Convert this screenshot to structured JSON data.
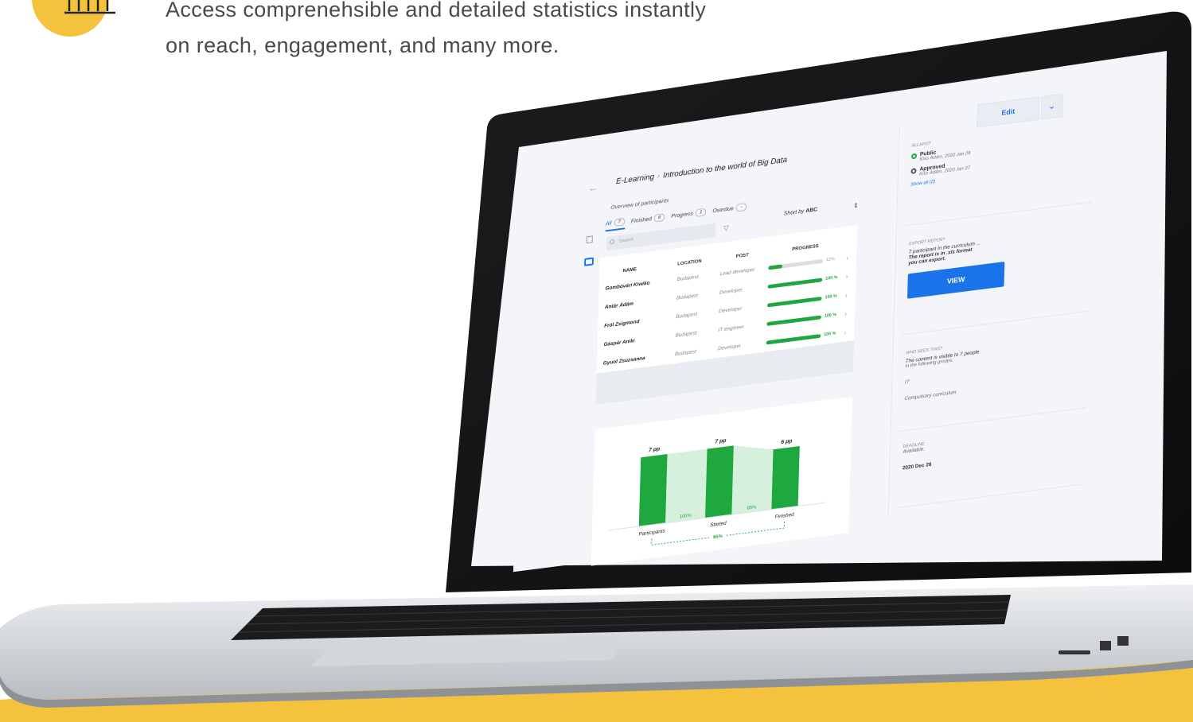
{
  "hero": {
    "line1": "Access comprenehsible and detailed  statistics instantly",
    "line2": "on reach, engagement, and many more."
  },
  "colors": {
    "accent_yellow": "#f5c23e",
    "primary_blue": "#1a73e8",
    "success_green": "#1fa840"
  },
  "icons": {
    "stats": "bar-chart-icon",
    "back": "back-arrow-icon",
    "search": "search-icon",
    "filter": "filter-icon",
    "sort": "sort-icon",
    "row_chevron": "chevron-right-icon",
    "dropdown": "chevron-down-icon"
  },
  "app": {
    "edit_label": "Edit",
    "dropdown_glyph": "⌄",
    "back_glyph": "←",
    "breadcrumb": {
      "root": "E-Learning",
      "sep": "›",
      "current": "Introduction to the world of Big Data"
    },
    "overview_label": "Overview of participants",
    "tabs": [
      {
        "label": "All",
        "count": "7"
      },
      {
        "label": "Finished",
        "count": "6"
      },
      {
        "label": "Progress",
        "count": "1"
      },
      {
        "label": "Overdue",
        "count": "-"
      }
    ],
    "search_placeholder": "Search",
    "sort_label": "Short by",
    "sort_value": "ABC",
    "columns": {
      "name": "NAME",
      "location": "LOCATION",
      "post": "POST",
      "progress": "PROGRESS"
    },
    "rows": [
      {
        "name": "Gombóvári Kiwiko",
        "location": "Budapest",
        "post": "Lead developer",
        "progress": 0.12,
        "pct": "12%"
      },
      {
        "name": "Antár Ádám",
        "location": "Budapest",
        "post": "Developer",
        "progress": 1.0,
        "pct": "100 %"
      },
      {
        "name": "Fról Zsigmond",
        "location": "Budapest",
        "post": "Developer",
        "progress": 1.0,
        "pct": "100 %"
      },
      {
        "name": "Gáspár Aniki",
        "location": "Budapest",
        "post": "IT engineer",
        "progress": 1.0,
        "pct": "100 %"
      },
      {
        "name": "Gyuol Zsuzsanna",
        "location": "Budapest",
        "post": "Developer",
        "progress": 1.0,
        "pct": "100 %"
      }
    ],
    "right": {
      "status_heading": "ÁLLAPOT",
      "statuses": [
        {
          "name": "Public",
          "sub": "Kiss Ádám, 2020 Jan 28"
        },
        {
          "name": "Approved",
          "sub": "Kiss Ádám, 2020 Jan 27"
        }
      ],
      "show_all": "Show all (2)",
      "export_heading": "EXPORT REPORT",
      "export_line1": "7 participant in the curriculum ...",
      "export_line2": "The report is in .xls format",
      "export_line3": "you can export.",
      "view_label": "VIEW",
      "who_heading": "WHO SEES THIS?",
      "who_line1": "The content is visible to 7 people",
      "who_line2": "in the following groups:",
      "group1": "IT",
      "group2": "Compulsory curriculum",
      "deadline_heading": "DEADLINE",
      "deadline_sub": "Available:",
      "deadline_value": "2020 Dec 28"
    }
  },
  "chart_data": {
    "type": "bar",
    "categories": [
      "Participants",
      "Started",
      "Finished"
    ],
    "values": [
      7,
      7,
      6
    ],
    "value_labels": [
      "7 pp",
      "7 pp",
      "6 pp"
    ],
    "conversion_labels": [
      "100%",
      "85%"
    ],
    "overall_label": "85%",
    "ylim": [
      0,
      8
    ],
    "grid": false,
    "color": "#1fa840"
  }
}
